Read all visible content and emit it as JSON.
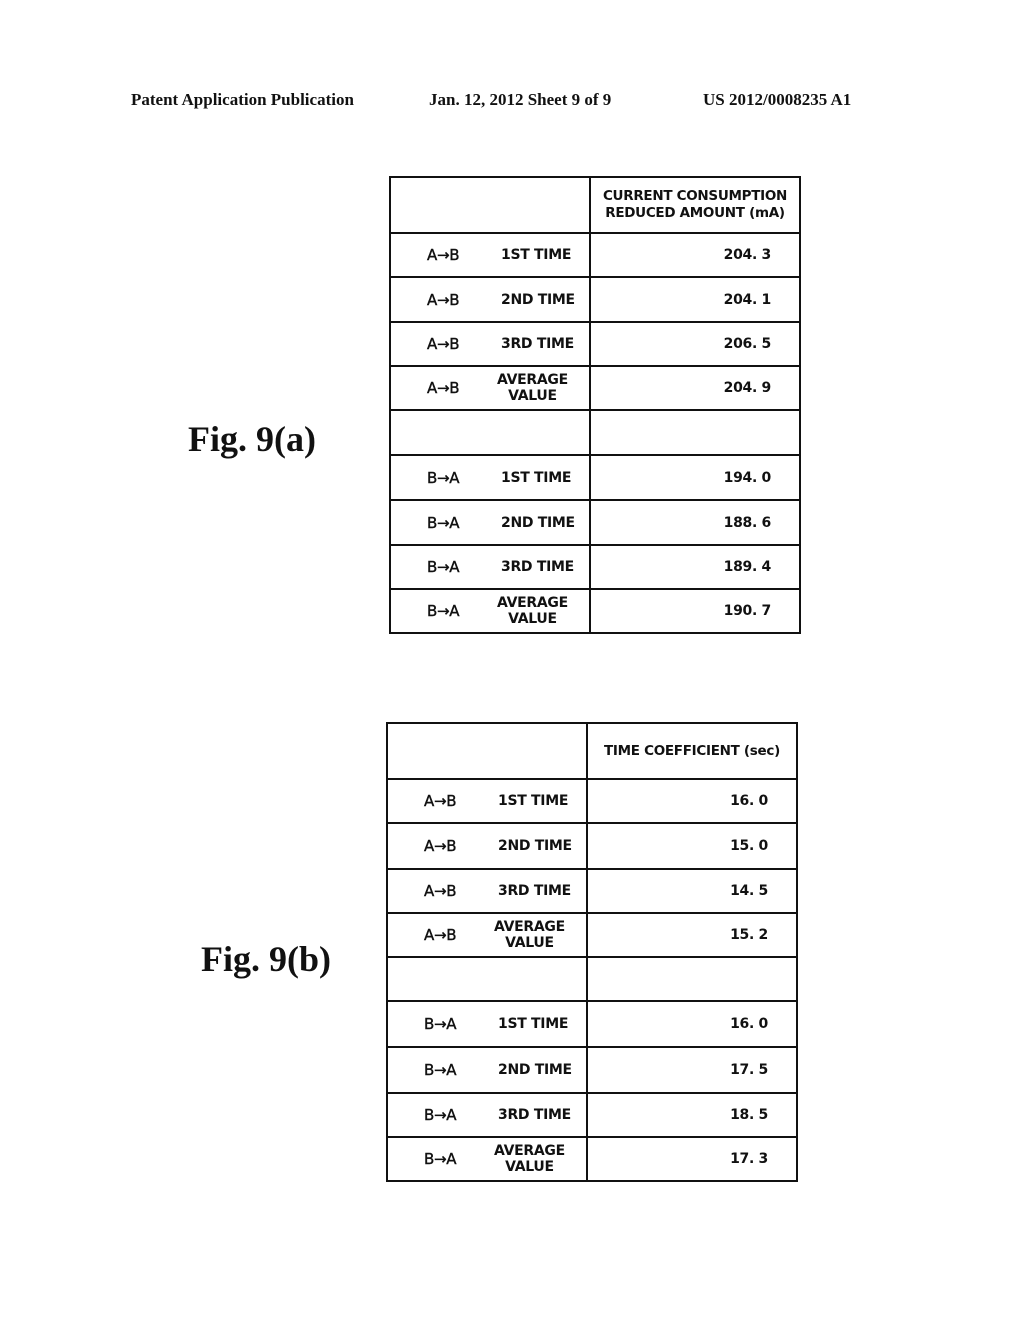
{
  "header": {
    "publication": "Patent Application Publication",
    "date_sheet": "Jan. 12, 2012   Sheet 9 of 9",
    "number": "US 2012/0008235 A1"
  },
  "figures": [
    {
      "label": "Fig. 9(a)",
      "column_header_line1": "CURRENT CONSUMPTION",
      "column_header_line2": "REDUCED AMOUNT (mA)",
      "rows": [
        {
          "direction": "A→B",
          "kind": "1ST TIME",
          "value": "204. 3"
        },
        {
          "direction": "A→B",
          "kind": "2ND TIME",
          "value": "204. 1"
        },
        {
          "direction": "A→B",
          "kind": "3RD TIME",
          "value": "206. 5"
        },
        {
          "direction": "A→B",
          "kind": "AVERAGE",
          "kind2": "VALUE",
          "value": "204. 9"
        },
        {
          "direction": "",
          "kind": "",
          "value": ""
        },
        {
          "direction": "B→A",
          "kind": "1ST TIME",
          "value": "194. 0"
        },
        {
          "direction": "B→A",
          "kind": "2ND TIME",
          "value": "188. 6"
        },
        {
          "direction": "B→A",
          "kind": "3RD TIME",
          "value": "189. 4"
        },
        {
          "direction": "B→A",
          "kind": "AVERAGE",
          "kind2": "VALUE",
          "value": "190. 7"
        }
      ]
    },
    {
      "label": "Fig. 9(b)",
      "column_header_line1": "TIME COEFFICIENT (sec)",
      "column_header_line2": "",
      "rows": [
        {
          "direction": "A→B",
          "kind": "1ST TIME",
          "value": "16. 0"
        },
        {
          "direction": "A→B",
          "kind": "2ND TIME",
          "value": "15. 0"
        },
        {
          "direction": "A→B",
          "kind": "3RD TIME",
          "value": "14. 5"
        },
        {
          "direction": "A→B",
          "kind": "AVERAGE",
          "kind2": "VALUE",
          "value": "15. 2"
        },
        {
          "direction": "",
          "kind": "",
          "value": ""
        },
        {
          "direction": "B→A",
          "kind": "1ST TIME",
          "value": "16. 0"
        },
        {
          "direction": "B→A",
          "kind": "2ND TIME",
          "value": "17. 5"
        },
        {
          "direction": "B→A",
          "kind": "3RD TIME",
          "value": "18. 5"
        },
        {
          "direction": "B→A",
          "kind": "AVERAGE",
          "kind2": "VALUE",
          "value": "17. 3"
        }
      ]
    }
  ]
}
